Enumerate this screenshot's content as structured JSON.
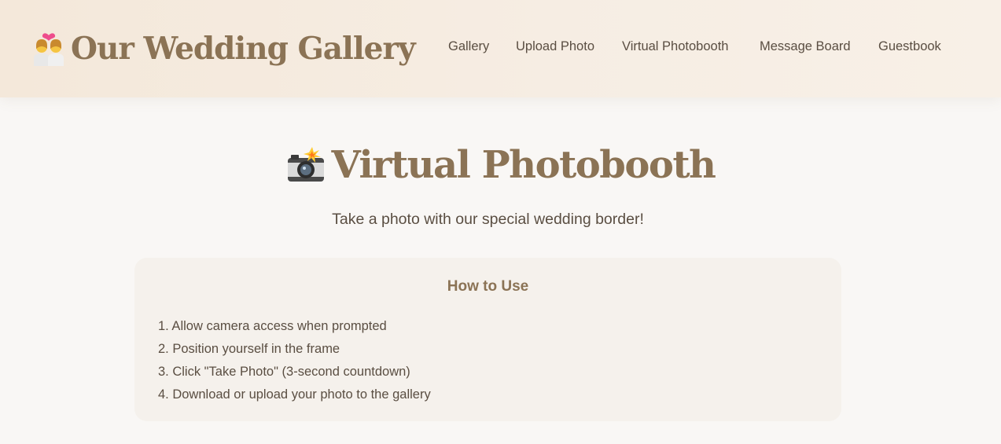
{
  "header": {
    "brand_icon": "couple-with-heart-icon",
    "brand_title": "Our Wedding Gallery",
    "nav": [
      "Gallery",
      "Upload Photo",
      "Virtual Photobooth",
      "Message Board",
      "Guestbook"
    ]
  },
  "main": {
    "title_icon": "camera-with-flash-icon",
    "title": "Virtual Photobooth",
    "subtitle": "Take a photo with our special wedding border!",
    "instructions": {
      "heading": "How to Use",
      "steps": [
        "1. Allow camera access when prompted",
        "2. Position yourself in the frame",
        "3. Click \"Take Photo\" (3-second countdown)",
        "4. Download or upload your photo to the gallery"
      ]
    }
  },
  "colors": {
    "accent": "#8b7355",
    "text": "#5a4e42",
    "header_bg": "#f4e8da",
    "page_bg": "#f9f7f5",
    "card_bg": "#f5f1ec"
  }
}
